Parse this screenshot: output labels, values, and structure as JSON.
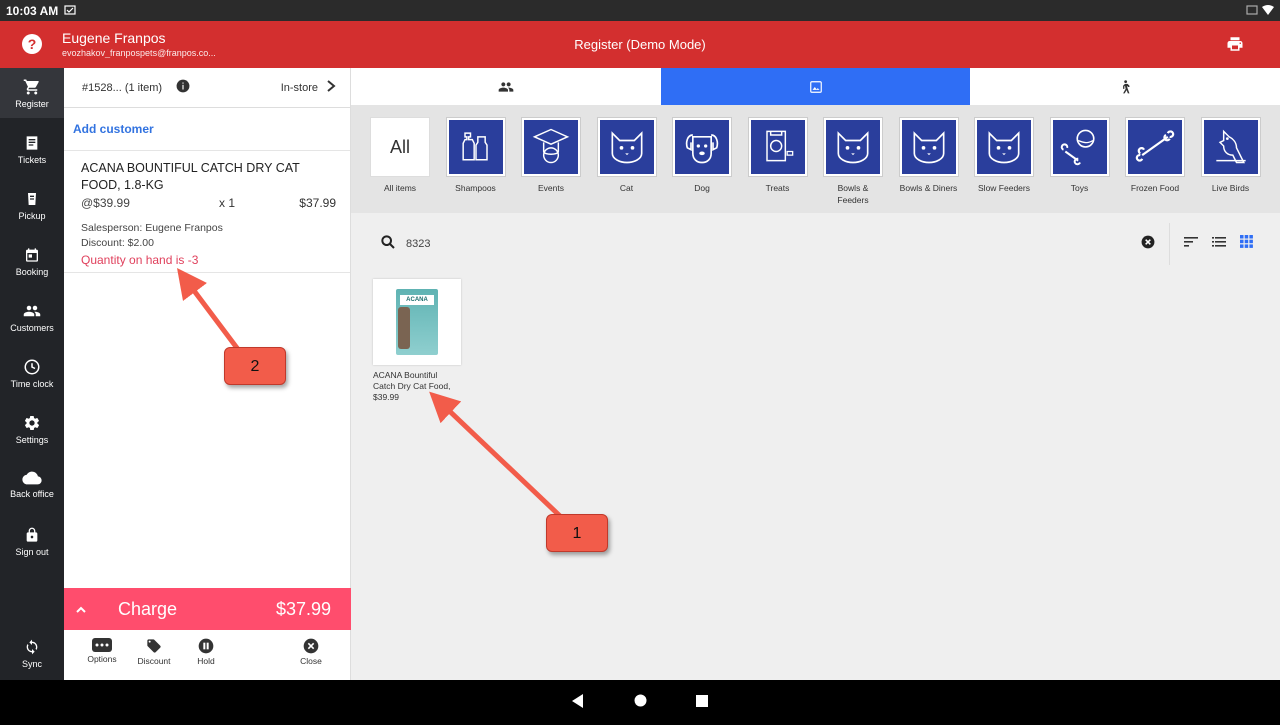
{
  "status": {
    "time": "10:03 AM"
  },
  "appbar": {
    "user_name": "Eugene Franpos",
    "user_email": "evozhakov_franpospets@franpos.co...",
    "title": "Register  (Demo Mode)",
    "help": "?"
  },
  "sidebar": {
    "items": [
      {
        "label": "Register",
        "icon": "cart-icon"
      },
      {
        "label": "Tickets",
        "icon": "receipt-icon"
      },
      {
        "label": "Pickup",
        "icon": "pickup-icon"
      },
      {
        "label": "Booking",
        "icon": "calendar-icon"
      },
      {
        "label": "Customers",
        "icon": "people-icon"
      },
      {
        "label": "Time clock",
        "icon": "clock-icon"
      },
      {
        "label": "Settings",
        "icon": "gear-icon"
      },
      {
        "label": "Back office",
        "icon": "cloud-icon"
      },
      {
        "label": "Sign out",
        "icon": "lock-icon"
      }
    ],
    "sync_label": "Sync"
  },
  "cart": {
    "order_id": "#1528... (1 item)",
    "channel": "In-store",
    "add_customer": "Add customer",
    "line": {
      "name": "ACANA BOUNTIFUL CATCH DRY CAT FOOD, 1.8-KG",
      "unit_price": "@$39.99",
      "qty": "x  1",
      "total": "$37.99",
      "salesperson": "Salesperson: Eugene Franpos",
      "discount": "Discount: $2.00",
      "warning": "Quantity on hand is -3"
    },
    "charge_label": "Charge",
    "charge_total": "$37.99",
    "actions": {
      "options": "Options",
      "discount": "Discount",
      "hold": "Hold",
      "close": "Close"
    }
  },
  "categories": [
    {
      "label": "All items",
      "tile": "All"
    },
    {
      "label": "Shampoos",
      "icon": "shampoo-icon"
    },
    {
      "label": "Events",
      "icon": "graduate-dog-icon"
    },
    {
      "label": "Cat",
      "icon": "cat-icon"
    },
    {
      "label": "Dog",
      "icon": "dog-icon"
    },
    {
      "label": "Treats",
      "icon": "treat-bag-icon"
    },
    {
      "label": "Bowls & Feeders",
      "icon": "cat-icon"
    },
    {
      "label": "Bowls & Diners",
      "icon": "cat-icon"
    },
    {
      "label": "Slow Feeders",
      "icon": "cat-icon"
    },
    {
      "label": "Toys",
      "icon": "ball-bone-icon"
    },
    {
      "label": "Frozen Food",
      "icon": "bone-icon"
    },
    {
      "label": "Live Birds",
      "icon": "bird-icon"
    }
  ],
  "search": {
    "query": "8323"
  },
  "product": {
    "brand": "ACANA",
    "name": "ACANA Bountiful Catch Dry Cat Food,",
    "price": "$39.99"
  },
  "callouts": {
    "one": "1",
    "two": "2"
  },
  "colors": {
    "appbar": "#d32f2f",
    "charge": "#ff4d6d",
    "tab_active": "#2f6ef5",
    "category_tile": "#2a3e9c",
    "warning": "#e0405c"
  }
}
